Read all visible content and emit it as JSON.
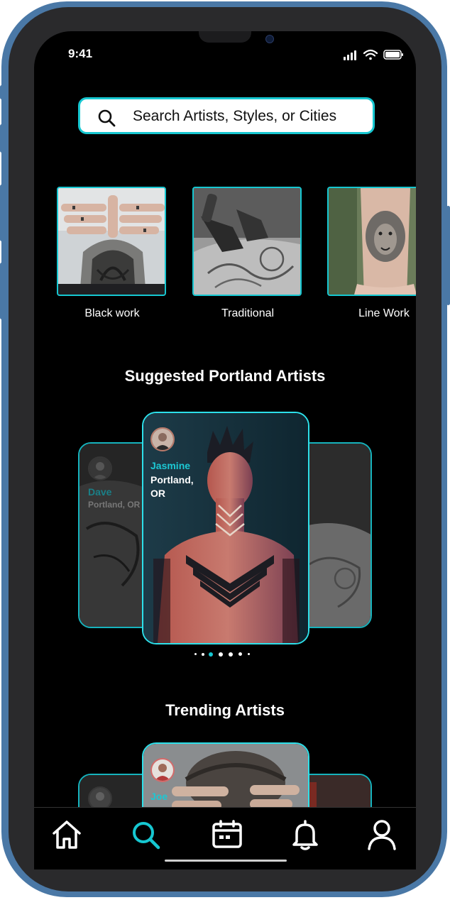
{
  "status": {
    "time": "9:41"
  },
  "search": {
    "placeholder": "Search Artists, Styles, or Cities"
  },
  "styles": [
    {
      "label": "Black work"
    },
    {
      "label": "Traditional"
    },
    {
      "label": "Line Work"
    }
  ],
  "suggested": {
    "title": "Suggested Portland Artists",
    "main_artist": {
      "name": "Jasmine",
      "location_line1": "Portland,",
      "location_line2": "OR"
    },
    "side_artist": {
      "name": "Dave",
      "location": "Portland, OR"
    },
    "carousel_dots": 7,
    "carousel_active_index": 2
  },
  "trending": {
    "title": "Trending Artists",
    "main_artist": {
      "name": "Joe"
    }
  },
  "nav": [
    {
      "icon": "home-icon",
      "active": false
    },
    {
      "icon": "search-icon",
      "active": true
    },
    {
      "icon": "calendar-icon",
      "active": false
    },
    {
      "icon": "bell-icon",
      "active": false
    },
    {
      "icon": "user-icon",
      "active": false
    }
  ],
  "colors": {
    "accent": "#16c7d1",
    "frame": "#4a78a6",
    "background": "#000000"
  }
}
